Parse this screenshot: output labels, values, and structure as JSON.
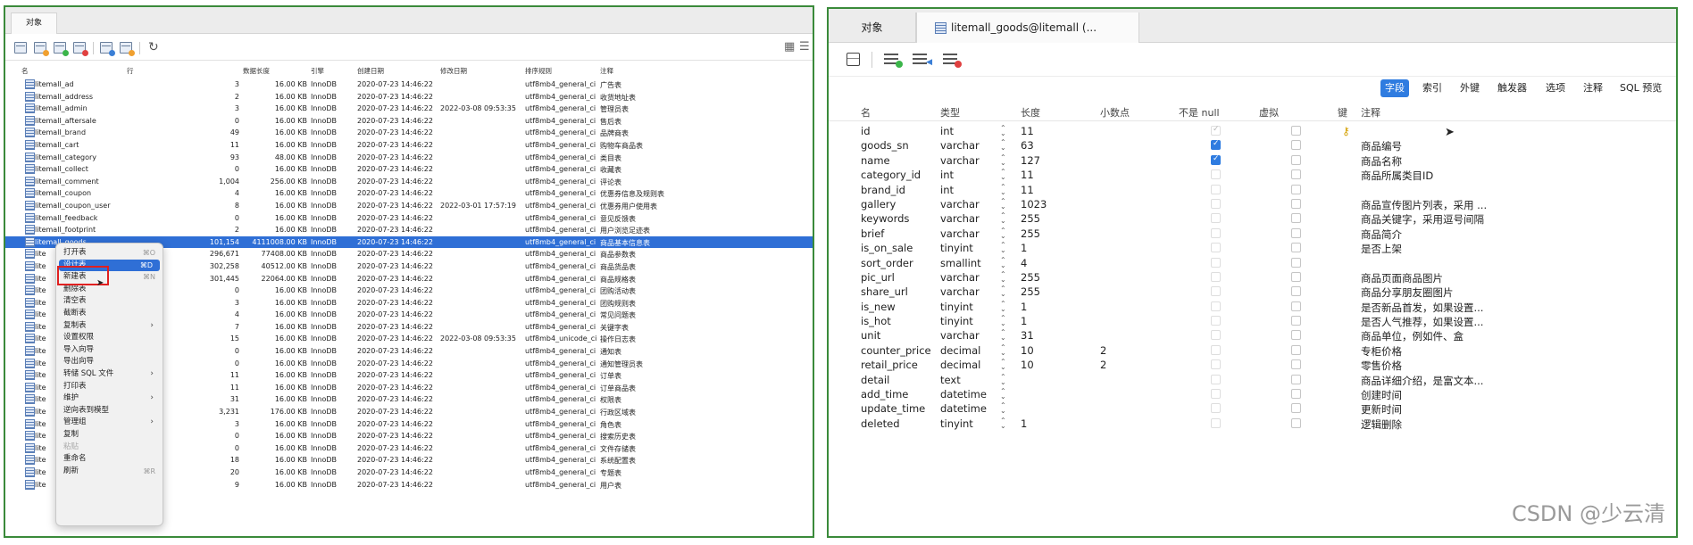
{
  "left": {
    "tab_label": "对象",
    "columns": [
      "名",
      "行",
      "数据长度",
      "引擎",
      "创建日期",
      "修改日期",
      "排序规则",
      "注释"
    ],
    "tables": [
      {
        "name": "litemall_ad",
        "rows": "3",
        "size": "16.00 KB",
        "engine": "InnoDB",
        "created": "2020-07-23 14:46:22",
        "modified": "",
        "collation": "utf8mb4_general_ci",
        "comment": "广告表"
      },
      {
        "name": "litemall_address",
        "rows": "2",
        "size": "16.00 KB",
        "engine": "InnoDB",
        "created": "2020-07-23 14:46:22",
        "modified": "",
        "collation": "utf8mb4_general_ci",
        "comment": "收货地址表"
      },
      {
        "name": "litemall_admin",
        "rows": "3",
        "size": "16.00 KB",
        "engine": "InnoDB",
        "created": "2020-07-23 14:46:22",
        "modified": "2022-03-08 09:53:35",
        "collation": "utf8mb4_general_ci",
        "comment": "管理员表"
      },
      {
        "name": "litemall_aftersale",
        "rows": "0",
        "size": "16.00 KB",
        "engine": "InnoDB",
        "created": "2020-07-23 14:46:22",
        "modified": "",
        "collation": "utf8mb4_general_ci",
        "comment": "售后表"
      },
      {
        "name": "litemall_brand",
        "rows": "49",
        "size": "16.00 KB",
        "engine": "InnoDB",
        "created": "2020-07-23 14:46:22",
        "modified": "",
        "collation": "utf8mb4_general_ci",
        "comment": "品牌商表"
      },
      {
        "name": "litemall_cart",
        "rows": "11",
        "size": "16.00 KB",
        "engine": "InnoDB",
        "created": "2020-07-23 14:46:22",
        "modified": "",
        "collation": "utf8mb4_general_ci",
        "comment": "购物车商品表"
      },
      {
        "name": "litemall_category",
        "rows": "93",
        "size": "48.00 KB",
        "engine": "InnoDB",
        "created": "2020-07-23 14:46:22",
        "modified": "",
        "collation": "utf8mb4_general_ci",
        "comment": "类目表"
      },
      {
        "name": "litemall_collect",
        "rows": "0",
        "size": "16.00 KB",
        "engine": "InnoDB",
        "created": "2020-07-23 14:46:22",
        "modified": "",
        "collation": "utf8mb4_general_ci",
        "comment": "收藏表"
      },
      {
        "name": "litemall_comment",
        "rows": "1,004",
        "size": "256.00 KB",
        "engine": "InnoDB",
        "created": "2020-07-23 14:46:22",
        "modified": "",
        "collation": "utf8mb4_general_ci",
        "comment": "评论表"
      },
      {
        "name": "litemall_coupon",
        "rows": "4",
        "size": "16.00 KB",
        "engine": "InnoDB",
        "created": "2020-07-23 14:46:22",
        "modified": "",
        "collation": "utf8mb4_general_ci",
        "comment": "优惠券信息及规则表"
      },
      {
        "name": "litemall_coupon_user",
        "rows": "8",
        "size": "16.00 KB",
        "engine": "InnoDB",
        "created": "2020-07-23 14:46:22",
        "modified": "2022-03-01 17:57:19",
        "collation": "utf8mb4_general_ci",
        "comment": "优惠券用户使用表"
      },
      {
        "name": "litemall_feedback",
        "rows": "0",
        "size": "16.00 KB",
        "engine": "InnoDB",
        "created": "2020-07-23 14:46:22",
        "modified": "",
        "collation": "utf8mb4_general_ci",
        "comment": "意见反馈表"
      },
      {
        "name": "litemall_footprint",
        "rows": "2",
        "size": "16.00 KB",
        "engine": "InnoDB",
        "created": "2020-07-23 14:46:22",
        "modified": "",
        "collation": "utf8mb4_general_ci",
        "comment": "用户浏览足迹表"
      },
      {
        "name": "litemall_goods",
        "rows": "101,154",
        "size": "4111008.00 KB",
        "engine": "InnoDB",
        "created": "2020-07-23 14:46:22",
        "modified": "",
        "collation": "utf8mb4_general_ci",
        "comment": "商品基本信息表"
      },
      {
        "name": "lite",
        "rows": "296,671",
        "size": "77408.00 KB",
        "engine": "InnoDB",
        "created": "2020-07-23 14:46:22",
        "modified": "",
        "collation": "utf8mb4_general_ci",
        "comment": "商品参数表"
      },
      {
        "name": "lite",
        "rows": "302,258",
        "size": "40512.00 KB",
        "engine": "InnoDB",
        "created": "2020-07-23 14:46:22",
        "modified": "",
        "collation": "utf8mb4_general_ci",
        "comment": "商品货品表"
      },
      {
        "name": "lite",
        "rows": "301,445",
        "size": "22064.00 KB",
        "engine": "InnoDB",
        "created": "2020-07-23 14:46:22",
        "modified": "",
        "collation": "utf8mb4_general_ci",
        "comment": "商品规格表"
      },
      {
        "name": "lite",
        "rows": "0",
        "size": "16.00 KB",
        "engine": "InnoDB",
        "created": "2020-07-23 14:46:22",
        "modified": "",
        "collation": "utf8mb4_general_ci",
        "comment": "团购活动表"
      },
      {
        "name": "lite",
        "rows": "3",
        "size": "16.00 KB",
        "engine": "InnoDB",
        "created": "2020-07-23 14:46:22",
        "modified": "",
        "collation": "utf8mb4_general_ci",
        "comment": "团购规则表"
      },
      {
        "name": "lite",
        "rows": "4",
        "size": "16.00 KB",
        "engine": "InnoDB",
        "created": "2020-07-23 14:46:22",
        "modified": "",
        "collation": "utf8mb4_general_ci",
        "comment": "常见问题表"
      },
      {
        "name": "lite",
        "rows": "7",
        "size": "16.00 KB",
        "engine": "InnoDB",
        "created": "2020-07-23 14:46:22",
        "modified": "",
        "collation": "utf8mb4_general_ci",
        "comment": "关键字表"
      },
      {
        "name": "lite",
        "rows": "15",
        "size": "16.00 KB",
        "engine": "InnoDB",
        "created": "2020-07-23 14:46:22",
        "modified": "2022-03-08 09:53:35",
        "collation": "utf8mb4_unicode_ci",
        "comment": "操作日志表"
      },
      {
        "name": "lite",
        "rows": "0",
        "size": "16.00 KB",
        "engine": "InnoDB",
        "created": "2020-07-23 14:46:22",
        "modified": "",
        "collation": "utf8mb4_general_ci",
        "comment": "通知表"
      },
      {
        "name": "lite",
        "rows": "0",
        "size": "16.00 KB",
        "engine": "InnoDB",
        "created": "2020-07-23 14:46:22",
        "modified": "",
        "collation": "utf8mb4_general_ci",
        "comment": "通知管理员表"
      },
      {
        "name": "lite",
        "rows": "11",
        "size": "16.00 KB",
        "engine": "InnoDB",
        "created": "2020-07-23 14:46:22",
        "modified": "",
        "collation": "utf8mb4_general_ci",
        "comment": "订单表"
      },
      {
        "name": "lite",
        "rows": "11",
        "size": "16.00 KB",
        "engine": "InnoDB",
        "created": "2020-07-23 14:46:22",
        "modified": "",
        "collation": "utf8mb4_general_ci",
        "comment": "订单商品表"
      },
      {
        "name": "lite",
        "rows": "31",
        "size": "16.00 KB",
        "engine": "InnoDB",
        "created": "2020-07-23 14:46:22",
        "modified": "",
        "collation": "utf8mb4_general_ci",
        "comment": "权限表"
      },
      {
        "name": "lite",
        "rows": "3,231",
        "size": "176.00 KB",
        "engine": "InnoDB",
        "created": "2020-07-23 14:46:22",
        "modified": "",
        "collation": "utf8mb4_general_ci",
        "comment": "行政区域表"
      },
      {
        "name": "lite",
        "rows": "3",
        "size": "16.00 KB",
        "engine": "InnoDB",
        "created": "2020-07-23 14:46:22",
        "modified": "",
        "collation": "utf8mb4_general_ci",
        "comment": "角色表"
      },
      {
        "name": "lite",
        "rows": "0",
        "size": "16.00 KB",
        "engine": "InnoDB",
        "created": "2020-07-23 14:46:22",
        "modified": "",
        "collation": "utf8mb4_general_ci",
        "comment": "搜索历史表"
      },
      {
        "name": "lite",
        "rows": "0",
        "size": "16.00 KB",
        "engine": "InnoDB",
        "created": "2020-07-23 14:46:22",
        "modified": "",
        "collation": "utf8mb4_general_ci",
        "comment": "文件存储表"
      },
      {
        "name": "lite",
        "rows": "18",
        "size": "16.00 KB",
        "engine": "InnoDB",
        "created": "2020-07-23 14:46:22",
        "modified": "",
        "collation": "utf8mb4_general_ci",
        "comment": "系统配置表"
      },
      {
        "name": "lite",
        "rows": "20",
        "size": "16.00 KB",
        "engine": "InnoDB",
        "created": "2020-07-23 14:46:22",
        "modified": "",
        "collation": "utf8mb4_general_ci",
        "comment": "专题表"
      },
      {
        "name": "lite",
        "rows": "9",
        "size": "16.00 KB",
        "engine": "InnoDB",
        "created": "2020-07-23 14:46:22",
        "modified": "",
        "collation": "utf8mb4_general_ci",
        "comment": "用户表"
      }
    ],
    "context_menu": [
      {
        "label": "打开表",
        "shortcut": "⌘O",
        "state": "normal",
        "submenu": false
      },
      {
        "label": "设计表",
        "shortcut": "⌘D",
        "state": "highlighted",
        "submenu": false
      },
      {
        "label": "新建表",
        "shortcut": "⌘N",
        "state": "normal",
        "submenu": false
      },
      {
        "label": "删除表",
        "shortcut": "",
        "state": "normal",
        "submenu": false
      },
      {
        "label": "清空表",
        "shortcut": "",
        "state": "normal",
        "submenu": false
      },
      {
        "label": "截断表",
        "shortcut": "",
        "state": "normal",
        "submenu": false
      },
      {
        "label": "复制表",
        "shortcut": "",
        "state": "normal",
        "submenu": true
      },
      {
        "label": "设置权限",
        "shortcut": "",
        "state": "normal",
        "submenu": false
      },
      {
        "label": "导入向导",
        "shortcut": "",
        "state": "normal",
        "submenu": false
      },
      {
        "label": "导出向导",
        "shortcut": "",
        "state": "normal",
        "submenu": false
      },
      {
        "label": "转储 SQL 文件",
        "shortcut": "",
        "state": "normal",
        "submenu": true
      },
      {
        "label": "打印表",
        "shortcut": "",
        "state": "normal",
        "submenu": false
      },
      {
        "label": "维护",
        "shortcut": "",
        "state": "normal",
        "submenu": true
      },
      {
        "label": "逆向表到模型",
        "shortcut": "",
        "state": "normal",
        "submenu": false
      },
      {
        "label": "管理组",
        "shortcut": "",
        "state": "normal",
        "submenu": true
      },
      {
        "label": "复制",
        "shortcut": "",
        "state": "normal",
        "submenu": false
      },
      {
        "label": "粘贴",
        "shortcut": "",
        "state": "disabled",
        "submenu": false
      },
      {
        "label": "重命名",
        "shortcut": "",
        "state": "normal",
        "submenu": false
      },
      {
        "label": "刷新",
        "shortcut": "⌘R",
        "state": "normal",
        "submenu": false
      }
    ]
  },
  "right": {
    "tab_objects": "对象",
    "tab_active": "litemall_goods@litemall (...",
    "subtabs": [
      "字段",
      "索引",
      "外键",
      "触发器",
      "选项",
      "注释",
      "SQL 预览"
    ],
    "active_subtab": "字段",
    "columns": [
      "名",
      "类型",
      "长度",
      "小数点",
      "不是 null",
      "虚拟",
      "键",
      "注释"
    ],
    "fields": [
      {
        "name": "id",
        "type": "int",
        "length": "11",
        "decimals": "",
        "not_null": true,
        "not_null_dim": true,
        "key": true,
        "comment": ""
      },
      {
        "name": "goods_sn",
        "type": "varchar",
        "length": "63",
        "decimals": "",
        "not_null": true,
        "not_null_dim": false,
        "key": false,
        "comment": "商品编号"
      },
      {
        "name": "name",
        "type": "varchar",
        "length": "127",
        "decimals": "",
        "not_null": true,
        "not_null_dim": false,
        "key": false,
        "comment": "商品名称"
      },
      {
        "name": "category_id",
        "type": "int",
        "length": "11",
        "decimals": "",
        "not_null": false,
        "not_null_dim": false,
        "key": false,
        "comment": "商品所属类目ID"
      },
      {
        "name": "brand_id",
        "type": "int",
        "length": "11",
        "decimals": "",
        "not_null": false,
        "not_null_dim": false,
        "key": false,
        "comment": ""
      },
      {
        "name": "gallery",
        "type": "varchar",
        "length": "1023",
        "decimals": "",
        "not_null": false,
        "not_null_dim": false,
        "key": false,
        "comment": "商品宣传图片列表，采用 ..."
      },
      {
        "name": "keywords",
        "type": "varchar",
        "length": "255",
        "decimals": "",
        "not_null": false,
        "not_null_dim": false,
        "key": false,
        "comment": "商品关键字，采用逗号间隔"
      },
      {
        "name": "brief",
        "type": "varchar",
        "length": "255",
        "decimals": "",
        "not_null": false,
        "not_null_dim": false,
        "key": false,
        "comment": "商品简介"
      },
      {
        "name": "is_on_sale",
        "type": "tinyint",
        "length": "1",
        "decimals": "",
        "not_null": false,
        "not_null_dim": false,
        "key": false,
        "comment": "是否上架"
      },
      {
        "name": "sort_order",
        "type": "smallint",
        "length": "4",
        "decimals": "",
        "not_null": false,
        "not_null_dim": false,
        "key": false,
        "comment": ""
      },
      {
        "name": "pic_url",
        "type": "varchar",
        "length": "255",
        "decimals": "",
        "not_null": false,
        "not_null_dim": false,
        "key": false,
        "comment": "商品页面商品图片"
      },
      {
        "name": "share_url",
        "type": "varchar",
        "length": "255",
        "decimals": "",
        "not_null": false,
        "not_null_dim": false,
        "key": false,
        "comment": "商品分享朋友圈图片"
      },
      {
        "name": "is_new",
        "type": "tinyint",
        "length": "1",
        "decimals": "",
        "not_null": false,
        "not_null_dim": false,
        "key": false,
        "comment": "是否新品首发，如果设置..."
      },
      {
        "name": "is_hot",
        "type": "tinyint",
        "length": "1",
        "decimals": "",
        "not_null": false,
        "not_null_dim": false,
        "key": false,
        "comment": "是否人气推荐，如果设置..."
      },
      {
        "name": "unit",
        "type": "varchar",
        "length": "31",
        "decimals": "",
        "not_null": false,
        "not_null_dim": false,
        "key": false,
        "comment": "商品单位，例如件、盒"
      },
      {
        "name": "counter_price",
        "type": "decimal",
        "length": "10",
        "decimals": "2",
        "not_null": false,
        "not_null_dim": false,
        "key": false,
        "comment": "专柜价格"
      },
      {
        "name": "retail_price",
        "type": "decimal",
        "length": "10",
        "decimals": "2",
        "not_null": false,
        "not_null_dim": false,
        "key": false,
        "comment": "零售价格"
      },
      {
        "name": "detail",
        "type": "text",
        "length": "",
        "decimals": "",
        "not_null": false,
        "not_null_dim": false,
        "key": false,
        "comment": "商品详细介绍，是富文本..."
      },
      {
        "name": "add_time",
        "type": "datetime",
        "length": "",
        "decimals": "",
        "not_null": false,
        "not_null_dim": false,
        "key": false,
        "comment": "创建时间"
      },
      {
        "name": "update_time",
        "type": "datetime",
        "length": "",
        "decimals": "",
        "not_null": false,
        "not_null_dim": false,
        "key": false,
        "comment": "更新时间"
      },
      {
        "name": "deleted",
        "type": "tinyint",
        "length": "1",
        "decimals": "",
        "not_null": false,
        "not_null_dim": false,
        "key": false,
        "comment": "逻辑删除"
      }
    ]
  },
  "watermark": "CSDN @少云清",
  "colors": {
    "frame": "#3a8a3a",
    "selection": "#2f6fd6",
    "accent": "#2f7ce0",
    "highlight_box": "#e02020"
  }
}
